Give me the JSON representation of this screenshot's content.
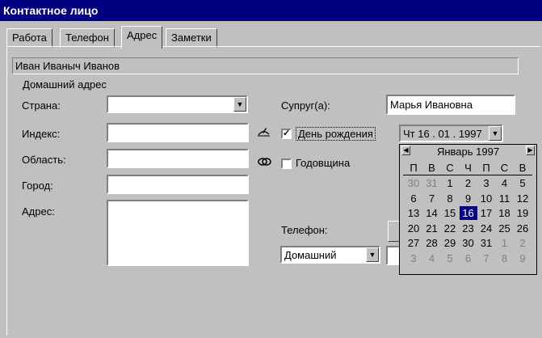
{
  "window": {
    "title": "Контактное лицо"
  },
  "tabs": [
    "Работа",
    "Телефон",
    "Адрес",
    "Заметки"
  ],
  "contact_name": "Иван Иваныч Иванов",
  "section_title": "Домашний адрес",
  "address": {
    "country_label": "Страна:",
    "country_value": "",
    "index_label": "Индекс:",
    "index_value": "",
    "region_label": "Область:",
    "region_value": "",
    "city_label": "Город:",
    "city_value": "",
    "address_label": "Адрес:",
    "address_value": ""
  },
  "spouse": {
    "label": "Супруг(а):",
    "value": "Марья Ивановна"
  },
  "birthday": {
    "label": "День рождения",
    "checked": true,
    "value": "Чт 16 . 01 . 1997"
  },
  "anniversary": {
    "label": "Годовщина",
    "checked": false
  },
  "phone": {
    "label": "Телефон:",
    "type": "Домашний",
    "value": ""
  },
  "calendar": {
    "month": "Январь 1997",
    "weekdays": [
      "П",
      "В",
      "С",
      "Ч",
      "П",
      "С",
      "В"
    ],
    "weeks": [
      [
        "30",
        "31",
        "1",
        "2",
        "3",
        "4",
        "5"
      ],
      [
        "6",
        "7",
        "8",
        "9",
        "10",
        "11",
        "12"
      ],
      [
        "13",
        "14",
        "15",
        "16",
        "17",
        "18",
        "19"
      ],
      [
        "20",
        "21",
        "22",
        "23",
        "24",
        "25",
        "26"
      ],
      [
        "27",
        "28",
        "29",
        "30",
        "31",
        "1",
        "2"
      ],
      [
        "3",
        "4",
        "5",
        "6",
        "7",
        "8",
        "9"
      ]
    ],
    "selected": "16"
  },
  "icons": {
    "spouse_icon": "pen-icon",
    "anniversary_icon": "rings-icon",
    "dropdown": "chevron-down-icon",
    "prev": "chevron-left-icon",
    "next": "chevron-right-icon"
  }
}
